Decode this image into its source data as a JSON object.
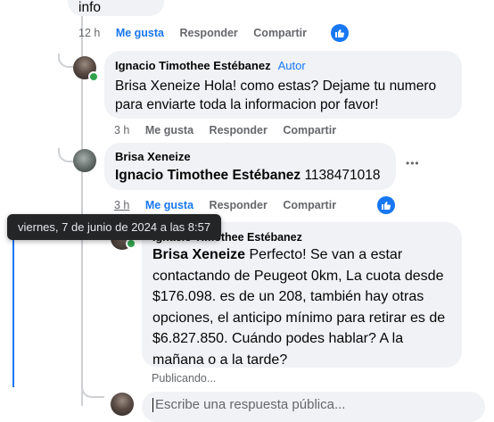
{
  "top_comment": {
    "snippet": "info",
    "time": "12 h",
    "like_label": "Me gusta",
    "reply_label": "Responder",
    "share_label": "Compartir"
  },
  "reply1": {
    "author": "Ignacio Timothee Estébanez",
    "badge": "Autor",
    "text": "Brisa Xeneize Hola! como estas? Dejame tu numero para enviarte toda la informacion por favor!",
    "time": "3 h",
    "like_label": "Me gusta",
    "reply_label": "Responder",
    "share_label": "Compartir"
  },
  "reply2": {
    "author": "Brisa Xeneize",
    "mention": "Ignacio Timothee Estébanez",
    "text": " 1138471018",
    "time": "3 h",
    "like_label": "Me gusta",
    "reply_label": "Responder",
    "share_label": "Compartir",
    "more_label": "•••"
  },
  "tooltip": {
    "text": "viernes, 7 de junio de 2024 a las 8:57"
  },
  "reply3": {
    "author": "Ignacio Timothee Estébanez",
    "mention": "Brisa Xeneize",
    "text": " Perfecto! Se van a estar contactando de Peugeot 0km, La cuota desde $176.098. es de un 208, también hay otras opciones, el anticipo mínimo para retirar es de $6.827.850. Cuándo podes hablar? A la mañana o a la tarde?",
    "status": "Publicando..."
  },
  "composer": {
    "placeholder": "Escribe una respuesta pública..."
  },
  "colors": {
    "accent": "#1877f2",
    "bubble": "#f0f2f5",
    "muted": "#65676b",
    "online": "#31a24c"
  }
}
